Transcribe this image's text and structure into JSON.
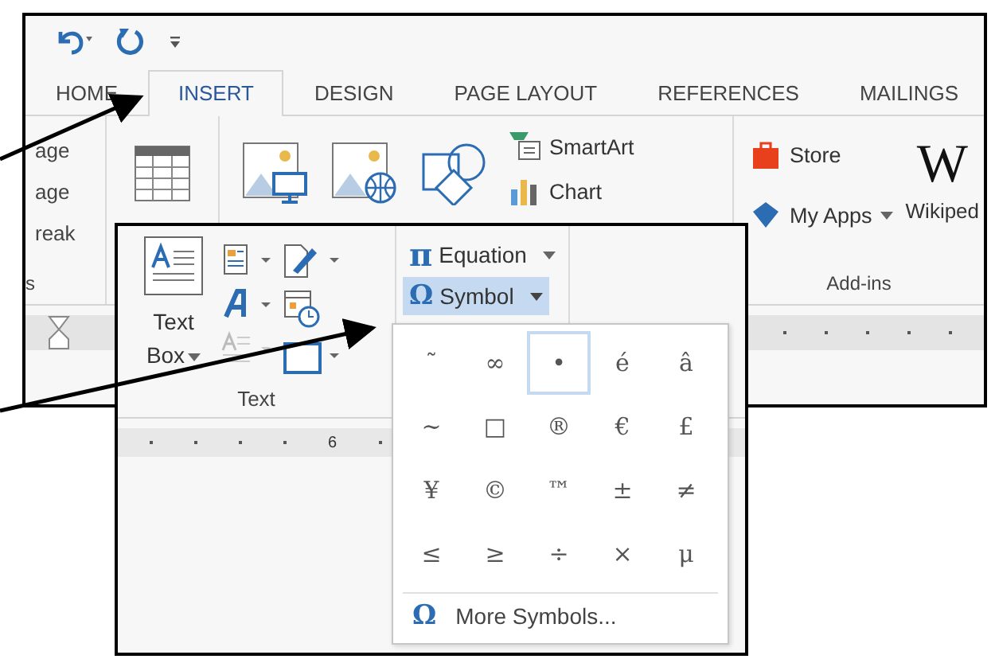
{
  "back_window": {
    "tabs": [
      {
        "label": "HOME",
        "selected": false
      },
      {
        "label": "INSERT",
        "selected": true
      },
      {
        "label": "DESIGN",
        "selected": false
      },
      {
        "label": "PAGE LAYOUT",
        "selected": false
      },
      {
        "label": "REFERENCES",
        "selected": false
      },
      {
        "label": "MAILINGS",
        "selected": false
      }
    ],
    "left_fragment": {
      "items": [
        "age",
        "age",
        "reak"
      ],
      "group_label": "s"
    },
    "smartart": "SmartArt",
    "chart": "Chart",
    "store": "Store",
    "my_apps": "My Apps",
    "wikipedia": "Wikiped",
    "wikipedia_logo": "W",
    "addins_label": "Add-ins"
  },
  "front_window": {
    "text_box": [
      "Text",
      "Box"
    ],
    "text_group_label": "Text",
    "equation_icon": "π",
    "equation": "Equation",
    "symbol": {
      "icon": "Ω",
      "label": "Symbol",
      "expanded": true
    },
    "ruler_number": "6",
    "gallery": {
      "symbols": [
        {
          "char": "˜",
          "selected": false
        },
        {
          "char": "∞",
          "selected": false
        },
        {
          "char": "•",
          "selected": true
        },
        {
          "char": "é",
          "selected": false
        },
        {
          "char": "â",
          "selected": false
        },
        {
          "char": "∼",
          "selected": false
        },
        {
          "char": "□",
          "selected": false
        },
        {
          "char": "®",
          "selected": false
        },
        {
          "char": "€",
          "selected": false
        },
        {
          "char": "£",
          "selected": false
        },
        {
          "char": "¥",
          "selected": false
        },
        {
          "char": "©",
          "selected": false
        },
        {
          "char": "™",
          "selected": false
        },
        {
          "char": "±",
          "selected": false
        },
        {
          "char": "≠",
          "selected": false
        },
        {
          "char": "≤",
          "selected": false
        },
        {
          "char": "≥",
          "selected": false
        },
        {
          "char": "÷",
          "selected": false
        },
        {
          "char": "×",
          "selected": false
        },
        {
          "char": "μ",
          "selected": false
        }
      ],
      "more_icon": "Ω",
      "more": "More Symbols..."
    }
  }
}
